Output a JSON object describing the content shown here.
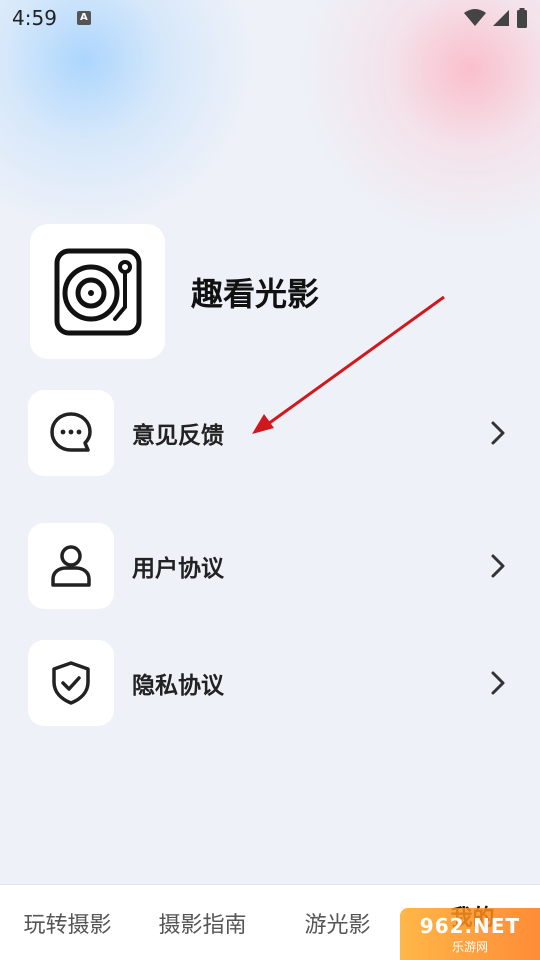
{
  "status_bar": {
    "time": "4:59",
    "notification_icon_letter": "A"
  },
  "app": {
    "name": "趣看光影",
    "logo_icon": "turntable-icon"
  },
  "menu": [
    {
      "label": "意见反馈",
      "icon": "chat-bubble-icon"
    },
    {
      "label": "用户协议",
      "icon": "user-icon"
    },
    {
      "label": "隐私协议",
      "icon": "shield-check-icon"
    }
  ],
  "tabs": [
    {
      "label": "玩转摄影"
    },
    {
      "label": "摄影指南"
    },
    {
      "label": "游光影"
    },
    {
      "label": "我的",
      "active": true
    }
  ],
  "watermark": {
    "top": "962.NET",
    "bottom": "乐游网"
  },
  "colors": {
    "background": "#eef1f8",
    "card": "#ffffff",
    "annotation_arrow": "#d0191f"
  }
}
